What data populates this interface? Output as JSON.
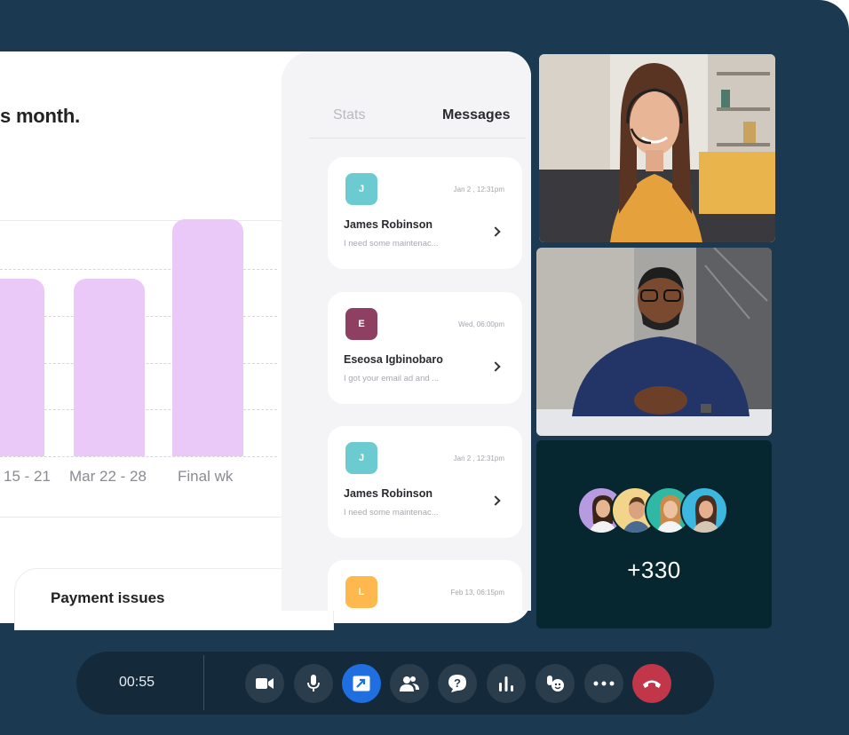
{
  "shared_screen": {
    "title": "s month.",
    "chart_labels": [
      "15 - 21",
      "Mar 22 - 28",
      "Final wk"
    ],
    "payment_title": "Payment issues"
  },
  "chart_data": {
    "type": "bar",
    "categories": [
      "15 - 21",
      "Mar 22 - 28",
      "Final wk"
    ],
    "values": [
      3,
      3,
      4
    ],
    "title": "",
    "xlabel": "",
    "ylabel": ""
  },
  "sidebar": {
    "tabs": [
      {
        "label": "Stats",
        "active": false
      },
      {
        "label": "Messages",
        "active": true
      }
    ],
    "messages": [
      {
        "initial": "J",
        "color": "#6ccbd0",
        "time": "Jan 2 , 12:31pm",
        "name": "James Robinson",
        "preview": "I need some maintenac..."
      },
      {
        "initial": "E",
        "color": "#8e3f62",
        "time": "Wed, 06:00pm",
        "name": "Eseosa Igbinobaro",
        "preview": "I got your email ad and ..."
      },
      {
        "initial": "J",
        "color": "#6ccbd0",
        "time": "Jan 2 , 12:31pm",
        "name": "James Robinson",
        "preview": "I need some maintenac..."
      },
      {
        "initial": "L",
        "color": "#ffb84d",
        "time": "Feb 13, 06:15pm",
        "name": "",
        "preview": ""
      }
    ]
  },
  "participants": {
    "extra_count": "+330"
  },
  "controls": {
    "timer": "00:55",
    "buttons": [
      "camera-icon",
      "microphone-icon",
      "share-screen-icon",
      "participants-icon",
      "help-icon",
      "stats-icon",
      "raise-hand-icon",
      "more-icon",
      "end-call-icon"
    ]
  },
  "colors": {
    "frame": "#1b3a52",
    "bar": "#eac8f7",
    "active_control": "#1f6fe0",
    "end_call": "#c2364a"
  }
}
